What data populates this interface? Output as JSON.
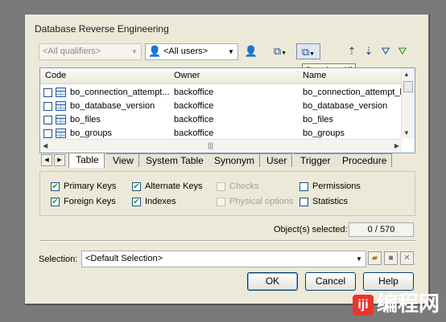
{
  "dialog": {
    "title": "Database Reverse Engineering"
  },
  "toolbar": {
    "qualifier_value": "<All qualifiers>",
    "owner_value": "<All users>",
    "tooltip": "Deselect All",
    "icons": {
      "owner": "user-icon",
      "select_all": "select-all-icon",
      "deselect_all": "deselect-all-icon",
      "sort_asc": "sort-ascending-icon",
      "sort_desc": "sort-descending-icon",
      "filter": "filter-icon",
      "filter_clear": "filter-clear-icon"
    }
  },
  "list": {
    "columns": [
      "Code",
      "Owner",
      "Name"
    ],
    "rows": [
      {
        "code": "bo_connection_attempt...",
        "owner": "backoffice",
        "name": "bo_connection_attempt_h"
      },
      {
        "code": "bo_database_version",
        "owner": "backoffice",
        "name": "bo_database_version"
      },
      {
        "code": "bo_files",
        "owner": "backoffice",
        "name": "bo_files"
      },
      {
        "code": "bo_groups",
        "owner": "backoffice",
        "name": "bo_groups"
      }
    ]
  },
  "tabs": [
    "Table",
    "View",
    "System Table",
    "Synonym",
    "User",
    "Trigger",
    "Procedure"
  ],
  "options": {
    "primary_keys": "Primary Keys",
    "foreign_keys": "Foreign Keys",
    "alternate_keys": "Alternate Keys",
    "indexes": "Indexes",
    "checks": "Checks",
    "physical_options": "Physical options",
    "permissions": "Permissions",
    "statistics": "Statistics"
  },
  "selected": {
    "label": "Object(s) selected:",
    "value": "0 / 570"
  },
  "selection": {
    "label": "Selection:",
    "value": "<Default Selection>"
  },
  "buttons": {
    "ok": "OK",
    "cancel": "Cancel",
    "help": "Help"
  },
  "watermark": {
    "logo": "iji",
    "text": "编程网"
  }
}
